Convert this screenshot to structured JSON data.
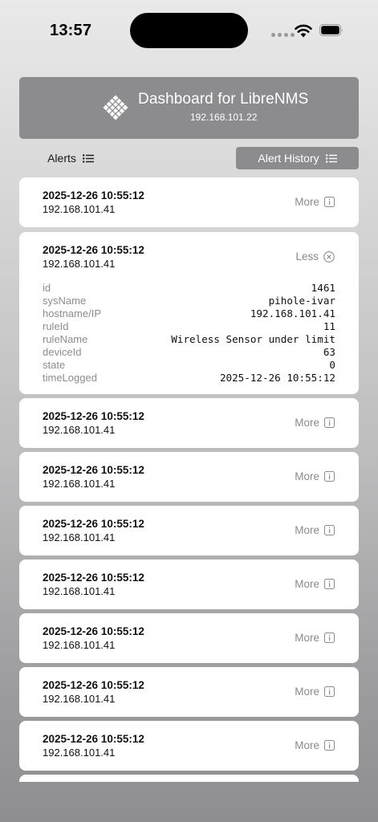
{
  "status_bar": {
    "time": "13:57"
  },
  "header": {
    "title": "Dashboard for LibreNMS",
    "subtitle": "192.168.101.22"
  },
  "tabs": {
    "alerts_label": "Alerts",
    "history_label": "Alert History"
  },
  "alerts": [
    {
      "date": "2025-12-26 10:55:12",
      "ip": "192.168.101.41",
      "action": "More"
    },
    {
      "date": "2025-12-26 10:55:12",
      "ip": "192.168.101.41",
      "action": "Less",
      "details": [
        {
          "key": "id",
          "value": "1461"
        },
        {
          "key": "sysName",
          "value": "pihole-ivar"
        },
        {
          "key": "hostname/IP",
          "value": "192.168.101.41"
        },
        {
          "key": "ruleId",
          "value": "11"
        },
        {
          "key": "ruleName",
          "value": "Wireless Sensor under limit"
        },
        {
          "key": "deviceId",
          "value": "63"
        },
        {
          "key": "state",
          "value": "0"
        },
        {
          "key": "timeLogged",
          "value": "2025-12-26 10:55:12"
        }
      ]
    },
    {
      "date": "2025-12-26 10:55:12",
      "ip": "192.168.101.41",
      "action": "More"
    },
    {
      "date": "2025-12-26 10:55:12",
      "ip": "192.168.101.41",
      "action": "More"
    },
    {
      "date": "2025-12-26 10:55:12",
      "ip": "192.168.101.41",
      "action": "More"
    },
    {
      "date": "2025-12-26 10:55:12",
      "ip": "192.168.101.41",
      "action": "More"
    },
    {
      "date": "2025-12-26 10:55:12",
      "ip": "192.168.101.41",
      "action": "More"
    },
    {
      "date": "2025-12-26 10:55:12",
      "ip": "192.168.101.41",
      "action": "More"
    },
    {
      "date": "2025-12-26 10:55:12",
      "ip": "192.168.101.41",
      "action": "More"
    }
  ],
  "icons": {
    "logo": "librenms-logo-icon",
    "list": "list-icon",
    "more": "info-icon",
    "less": "close-circle-icon",
    "wifi": "wifi-icon",
    "battery": "battery-icon",
    "signal": "signal-icon"
  },
  "colors": {
    "accent": "#8c8c8e",
    "card": "#ffffff",
    "muted_text": "#8a8a8a"
  }
}
